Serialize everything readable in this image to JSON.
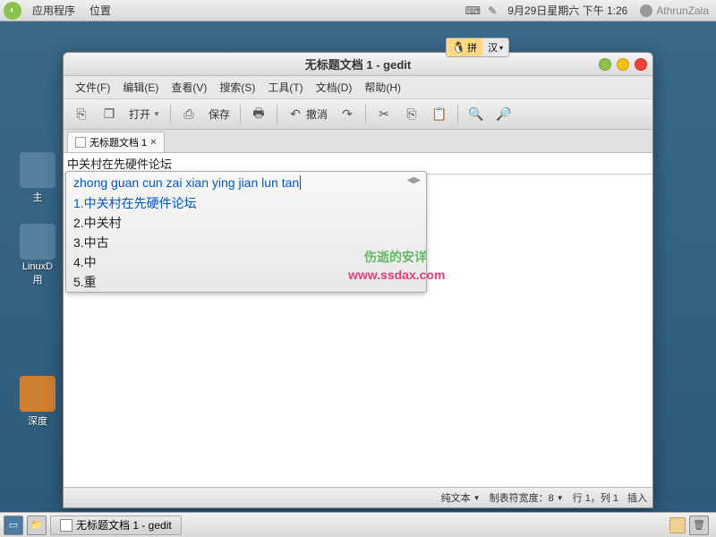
{
  "panel": {
    "apps": "应用程序",
    "places": "位置",
    "clock": "9月29日星期六 下午  1:26",
    "user": "AthrunZala"
  },
  "desktop": {
    "icon1": "主",
    "icon2": "LinuxD\n用",
    "icon3": "深度"
  },
  "ime_indicator": {
    "tab1": "拼",
    "tab2": "汉"
  },
  "window": {
    "title": "无标题文档 1 - gedit",
    "menus": {
      "file": "文件(F)",
      "edit": "编辑(E)",
      "view": "查看(V)",
      "search": "搜索(S)",
      "tools": "工具(T)",
      "documents": "文档(D)",
      "help": "帮助(H)"
    },
    "toolbar": {
      "open": "打开",
      "save": "保存",
      "undo": "撤消"
    },
    "tab": "无标题文档 1",
    "editor": {
      "line1": "中关村在先硬件论坛"
    },
    "ime_popup": {
      "pinyin": "zhong guan cun zai xian ying jian lun tan",
      "c1": "1.中关村在先硬件论坛",
      "c2": "2.中关村",
      "c3": "3.中古",
      "c4": "4.中",
      "c5": "5.重"
    },
    "watermark1": "伤逝的安详",
    "watermark2": "www.ssdax.com",
    "status": {
      "filetype": "纯文本",
      "tabwidth": "制表符宽度：8",
      "pos": "行 1，列 1",
      "mode": "插入"
    }
  },
  "taskbar": {
    "task1": "无标题文档 1 - gedit"
  }
}
